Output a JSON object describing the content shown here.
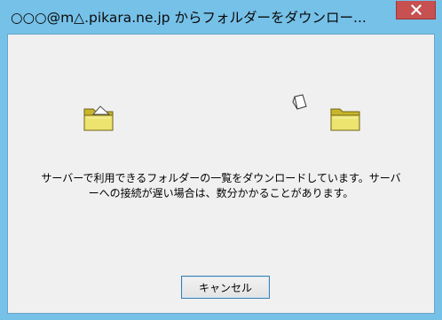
{
  "window": {
    "title": "○○○@m△.pikara.ne.jp からフォルダーをダウンロー...",
    "close_glyph": "×",
    "accent_color": "#76c1e8",
    "close_color": "#c75050"
  },
  "animation": {
    "source_icon": "folder-icon",
    "destination_icon": "folder-icon",
    "paper_icon": "flying-document-icon"
  },
  "message": {
    "line1": "サーバーで利用できるフォルダーの一覧をダウンロードしています。サーバ",
    "line2": "ーへの接続が遅い場合は、数分かかることがあります。"
  },
  "buttons": {
    "cancel_label": "キャンセル"
  }
}
